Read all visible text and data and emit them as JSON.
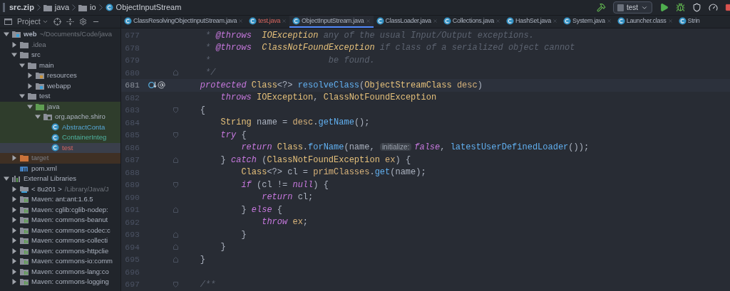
{
  "breadcrumb": [
    {
      "label": "src.zip",
      "kind": "archive"
    },
    {
      "label": "java",
      "kind": "folder"
    },
    {
      "label": "io",
      "kind": "folder"
    },
    {
      "label": "ObjectInputStream",
      "kind": "class"
    }
  ],
  "run_config": {
    "label": "test"
  },
  "project_panel": {
    "title": "Project"
  },
  "tabs": [
    {
      "label": "ClassResolvingObjectInputStream.java",
      "selected": false,
      "unversioned": false,
      "closable": true
    },
    {
      "label": "test.java",
      "selected": false,
      "unversioned": true,
      "closable": true
    },
    {
      "label": "ObjectInputStream.java",
      "selected": true,
      "unversioned": false,
      "closable": true
    },
    {
      "label": "ClassLoader.java",
      "selected": false,
      "unversioned": false,
      "closable": true
    },
    {
      "label": "Collections.java",
      "selected": false,
      "unversioned": false,
      "closable": true
    },
    {
      "label": "HashSet.java",
      "selected": false,
      "unversioned": false,
      "closable": true
    },
    {
      "label": "System.java",
      "selected": false,
      "unversioned": false,
      "closable": true
    },
    {
      "label": "Launcher.class",
      "selected": false,
      "unversioned": false,
      "closable": true
    },
    {
      "label": "Strin",
      "selected": false,
      "unversioned": false,
      "closable": false
    }
  ],
  "project_tree": [
    {
      "label": "web",
      "hint": "~/Documents/Code/java",
      "kind": "module",
      "expanded": true,
      "selected": false,
      "children": [
        {
          "label": ".idea",
          "kind": "folder",
          "expanded": false,
          "selected": false,
          "ignored": true
        },
        {
          "label": "src",
          "kind": "folder",
          "expanded": true,
          "selected": false,
          "children": [
            {
              "label": "main",
              "kind": "folder",
              "expanded": true,
              "selected": false,
              "children": [
                {
                  "label": "resources",
                  "kind": "resources",
                  "expanded": false,
                  "selected": false
                },
                {
                  "label": "webapp",
                  "kind": "web",
                  "expanded": false,
                  "selected": false
                }
              ]
            },
            {
              "label": "test",
              "kind": "folder",
              "expanded": true,
              "selected": false,
              "children": [
                {
                  "label": "java",
                  "kind": "test_source",
                  "expanded": true,
                  "selected": false,
                  "test_scope": true,
                  "children": [
                    {
                      "label": "org.apache.shiro",
                      "kind": "package",
                      "expanded": true,
                      "selected": false,
                      "test_scope": true,
                      "children": [
                        {
                          "label": "AbstractConta",
                          "kind": "class",
                          "selected": false,
                          "test_scope": true,
                          "modified": true
                        },
                        {
                          "label": "ContainerInteg",
                          "kind": "class",
                          "selected": false,
                          "test_scope": true,
                          "added": true
                        },
                        {
                          "label": "test",
                          "kind": "class",
                          "selected": true,
                          "test_scope": true,
                          "unversioned": true
                        }
                      ]
                    }
                  ]
                }
              ]
            }
          ]
        },
        {
          "label": "target",
          "kind": "excluded",
          "expanded": false,
          "selected": false,
          "excluded": true,
          "ignored": true
        },
        {
          "label": "pom.xml",
          "kind": "maven",
          "selected": false
        }
      ]
    },
    {
      "label": "External Libraries",
      "kind": "libraries",
      "expanded": true,
      "selected": false,
      "children": [
        {
          "label": "< 8u201 >",
          "hint": "/Library/Java/J",
          "kind": "jdk",
          "expanded": false,
          "selected": false
        },
        {
          "label": "Maven: ant:ant:1.6.5",
          "kind": "library",
          "expanded": false,
          "selected": false
        },
        {
          "label": "Maven: cglib:cglib-nodep:",
          "kind": "library",
          "expanded": false,
          "selected": false
        },
        {
          "label": "Maven: commons-beanut",
          "kind": "library",
          "expanded": false,
          "selected": false
        },
        {
          "label": "Maven: commons-codec:c",
          "kind": "library",
          "expanded": false,
          "selected": false
        },
        {
          "label": "Maven: commons-collecti",
          "kind": "library",
          "expanded": false,
          "selected": false
        },
        {
          "label": "Maven: commons-httpclie",
          "kind": "library",
          "expanded": false,
          "selected": false
        },
        {
          "label": "Maven: commons-io:comm",
          "kind": "library",
          "expanded": false,
          "selected": false
        },
        {
          "label": "Maven: commons-lang:co",
          "kind": "library",
          "expanded": false,
          "selected": false
        },
        {
          "label": "Maven: commons-logging",
          "kind": "library",
          "expanded": false,
          "selected": false
        }
      ]
    }
  ],
  "code_lines": [
    {
      "number": "677",
      "tokens": [
        {
          "kind": "comment",
          "text": "     * "
        },
        {
          "kind": "doctag",
          "text": "@throws  "
        },
        {
          "kind": "doctype",
          "text": "IOException"
        },
        {
          "kind": "comment",
          "text": " any of the usual Input/Output exceptions."
        }
      ]
    },
    {
      "number": "678",
      "tokens": [
        {
          "kind": "comment",
          "text": "     * "
        },
        {
          "kind": "doctag",
          "text": "@throws  "
        },
        {
          "kind": "doctype",
          "text": "ClassNotFoundException"
        },
        {
          "kind": "comment",
          "text": " if class of a serialized object cannot"
        }
      ]
    },
    {
      "number": "679",
      "tokens": [
        {
          "kind": "comment",
          "text": "     *                       be found."
        }
      ]
    },
    {
      "number": "680",
      "fold_end": true,
      "tokens": [
        {
          "kind": "comment",
          "text": "     */"
        }
      ]
    },
    {
      "number": "681",
      "current": true,
      "overrides": true,
      "annotated": true,
      "tokens": [
        {
          "kind": "keyword",
          "text": "    protected "
        },
        {
          "kind": "type",
          "text": "Class"
        },
        {
          "kind": "plain",
          "text": "<?> "
        },
        {
          "kind": "method",
          "text": "resolveClass"
        },
        {
          "kind": "plain",
          "text": "("
        },
        {
          "kind": "type",
          "text": "ObjectStreamClass "
        },
        {
          "kind": "param",
          "text": "desc"
        },
        {
          "kind": "plain",
          "text": ")"
        }
      ]
    },
    {
      "number": "682",
      "tokens": [
        {
          "kind": "keyword",
          "text": "        throws "
        },
        {
          "kind": "type",
          "text": "IOException"
        },
        {
          "kind": "plain",
          "text": ", "
        },
        {
          "kind": "type",
          "text": "ClassNotFoundException"
        }
      ]
    },
    {
      "number": "683",
      "fold_start": true,
      "tokens": [
        {
          "kind": "plain",
          "text": "    {"
        }
      ]
    },
    {
      "number": "684",
      "tokens": [
        {
          "kind": "type",
          "text": "        String"
        },
        {
          "kind": "plain",
          "text": " name = "
        },
        {
          "kind": "param",
          "text": "desc"
        },
        {
          "kind": "plain",
          "text": "."
        },
        {
          "kind": "method",
          "text": "getName"
        },
        {
          "kind": "plain",
          "text": "();"
        }
      ]
    },
    {
      "number": "685",
      "fold_start": true,
      "tokens": [
        {
          "kind": "keyword",
          "text": "        try"
        },
        {
          "kind": "plain",
          "text": " {"
        }
      ]
    },
    {
      "number": "686",
      "tokens": [
        {
          "kind": "keyword",
          "text": "            return "
        },
        {
          "kind": "type",
          "text": "Class"
        },
        {
          "kind": "plain",
          "text": "."
        },
        {
          "kind": "method",
          "text": "forName"
        },
        {
          "kind": "plain",
          "text": "(name, "
        },
        {
          "kind": "hint",
          "text": "initialize:"
        },
        {
          "kind": "keyword",
          "text": "false"
        },
        {
          "kind": "plain",
          "text": ", "
        },
        {
          "kind": "method",
          "text": "latestUserDefinedLoader"
        },
        {
          "kind": "plain",
          "text": "());"
        }
      ]
    },
    {
      "number": "687",
      "fold_end": true,
      "tokens": [
        {
          "kind": "plain",
          "text": "        } "
        },
        {
          "kind": "keyword",
          "text": "catch"
        },
        {
          "kind": "plain",
          "text": " ("
        },
        {
          "kind": "type",
          "text": "ClassNotFoundException "
        },
        {
          "kind": "param",
          "text": "ex"
        },
        {
          "kind": "plain",
          "text": ") {"
        }
      ]
    },
    {
      "number": "688",
      "tokens": [
        {
          "kind": "type",
          "text": "            Class"
        },
        {
          "kind": "plain",
          "text": "<?> cl = "
        },
        {
          "kind": "param",
          "text": "primClasses"
        },
        {
          "kind": "plain",
          "text": "."
        },
        {
          "kind": "method",
          "text": "get"
        },
        {
          "kind": "plain",
          "text": "(name);"
        }
      ]
    },
    {
      "number": "689",
      "fold_start": true,
      "tokens": [
        {
          "kind": "keyword",
          "text": "            if"
        },
        {
          "kind": "plain",
          "text": " (cl != "
        },
        {
          "kind": "keyword",
          "text": "null"
        },
        {
          "kind": "plain",
          "text": ") {"
        }
      ]
    },
    {
      "number": "690",
      "tokens": [
        {
          "kind": "keyword",
          "text": "                return"
        },
        {
          "kind": "plain",
          "text": " cl;"
        }
      ]
    },
    {
      "number": "691",
      "fold_end": true,
      "tokens": [
        {
          "kind": "plain",
          "text": "            } "
        },
        {
          "kind": "keyword",
          "text": "else"
        },
        {
          "kind": "plain",
          "text": " {"
        }
      ]
    },
    {
      "number": "692",
      "tokens": [
        {
          "kind": "keyword",
          "text": "                throw "
        },
        {
          "kind": "param",
          "text": "ex"
        },
        {
          "kind": "plain",
          "text": ";"
        }
      ]
    },
    {
      "number": "693",
      "fold_end": true,
      "tokens": [
        {
          "kind": "plain",
          "text": "            }"
        }
      ]
    },
    {
      "number": "694",
      "fold_end": true,
      "tokens": [
        {
          "kind": "plain",
          "text": "        }"
        }
      ]
    },
    {
      "number": "695",
      "fold_end": true,
      "tokens": [
        {
          "kind": "plain",
          "text": "    }"
        }
      ]
    },
    {
      "number": "696"
    },
    {
      "number": "697",
      "fold_start": true,
      "tokens": [
        {
          "kind": "comment",
          "text": "    /**"
        }
      ]
    }
  ]
}
